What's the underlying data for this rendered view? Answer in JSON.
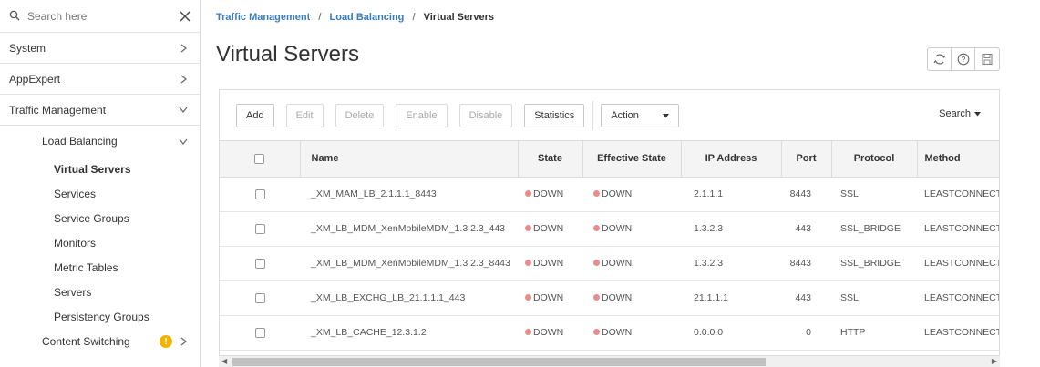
{
  "sidebar": {
    "search_placeholder": "Search here",
    "items": [
      {
        "label": "System"
      },
      {
        "label": "AppExpert"
      },
      {
        "label": "Traffic Management"
      },
      {
        "label": "Load Balancing"
      }
    ],
    "sub_items": [
      {
        "label": "Virtual Servers",
        "active": true
      },
      {
        "label": "Services"
      },
      {
        "label": "Service Groups"
      },
      {
        "label": "Monitors"
      },
      {
        "label": "Metric Tables"
      },
      {
        "label": "Servers"
      },
      {
        "label": "Persistency Groups"
      }
    ],
    "content_switching": {
      "label": "Content Switching",
      "badge": "!"
    }
  },
  "breadcrumb": {
    "items": [
      "Traffic Management",
      "Load Balancing",
      "Virtual Servers"
    ],
    "separator": "/"
  },
  "page_title": "Virtual Servers",
  "toolbar": {
    "add": "Add",
    "edit": "Edit",
    "delete": "Delete",
    "enable": "Enable",
    "disable": "Disable",
    "statistics": "Statistics",
    "action": "Action",
    "search": "Search"
  },
  "table": {
    "columns": [
      "Name",
      "State",
      "Effective State",
      "IP Address",
      "Port",
      "Protocol",
      "Method"
    ],
    "rows": [
      {
        "name": "_XM_MAM_LB_2.1.1.1_8443",
        "state": "DOWN",
        "effective_state": "DOWN",
        "ip": "2.1.1.1",
        "port": "8443",
        "protocol": "SSL",
        "method": "LEASTCONNECTION"
      },
      {
        "name": "_XM_LB_MDM_XenMobileMDM_1.3.2.3_443",
        "state": "DOWN",
        "effective_state": "DOWN",
        "ip": "1.3.2.3",
        "port": "443",
        "protocol": "SSL_BRIDGE",
        "method": "LEASTCONNECTION"
      },
      {
        "name": "_XM_LB_MDM_XenMobileMDM_1.3.2.3_8443",
        "state": "DOWN",
        "effective_state": "DOWN",
        "ip": "1.3.2.3",
        "port": "8443",
        "protocol": "SSL_BRIDGE",
        "method": "LEASTCONNECTION"
      },
      {
        "name": "_XM_LB_EXCHG_LB_21.1.1.1_443",
        "state": "DOWN",
        "effective_state": "DOWN",
        "ip": "21.1.1.1",
        "port": "443",
        "protocol": "SSL",
        "method": "LEASTCONNECTION"
      },
      {
        "name": "_XM_LB_CACHE_12.3.1.2",
        "state": "DOWN",
        "effective_state": "DOWN",
        "ip": "0.0.0.0",
        "port": "0",
        "protocol": "HTTP",
        "method": "LEASTCONNECTION"
      }
    ]
  },
  "colors": {
    "link": "#3a7bbf",
    "down_status": "#e88c8c",
    "warning": "#f2b400"
  }
}
